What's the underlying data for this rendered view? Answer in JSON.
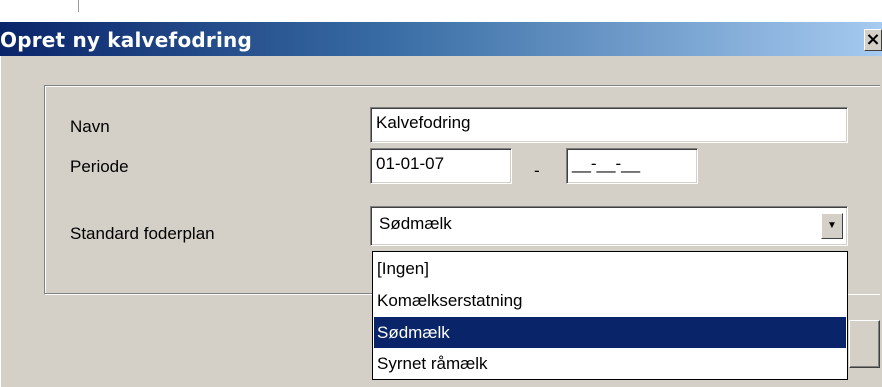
{
  "window": {
    "title": "Opret ny kalvefodring",
    "close_glyph": "×"
  },
  "form": {
    "name_label": "Navn",
    "name_value": "Kalvefodring",
    "period_label": "Periode",
    "period_from": "01-01-07",
    "period_separator": "-",
    "period_to": "__-__-__",
    "plan_label": "Standard foderplan",
    "plan_value": "Sødmælk",
    "plan_arrow_glyph": "▼"
  },
  "dropdown": {
    "options": [
      "[Ingen]",
      "Komælkserstatning",
      "Sødmælk",
      "Syrnet råmælk"
    ],
    "selected_index": 2
  },
  "colors": {
    "titlebar_start": "#0a246a",
    "titlebar_end": "#a6caf0",
    "selection": "#0a246a",
    "face": "#d4d0c8"
  }
}
